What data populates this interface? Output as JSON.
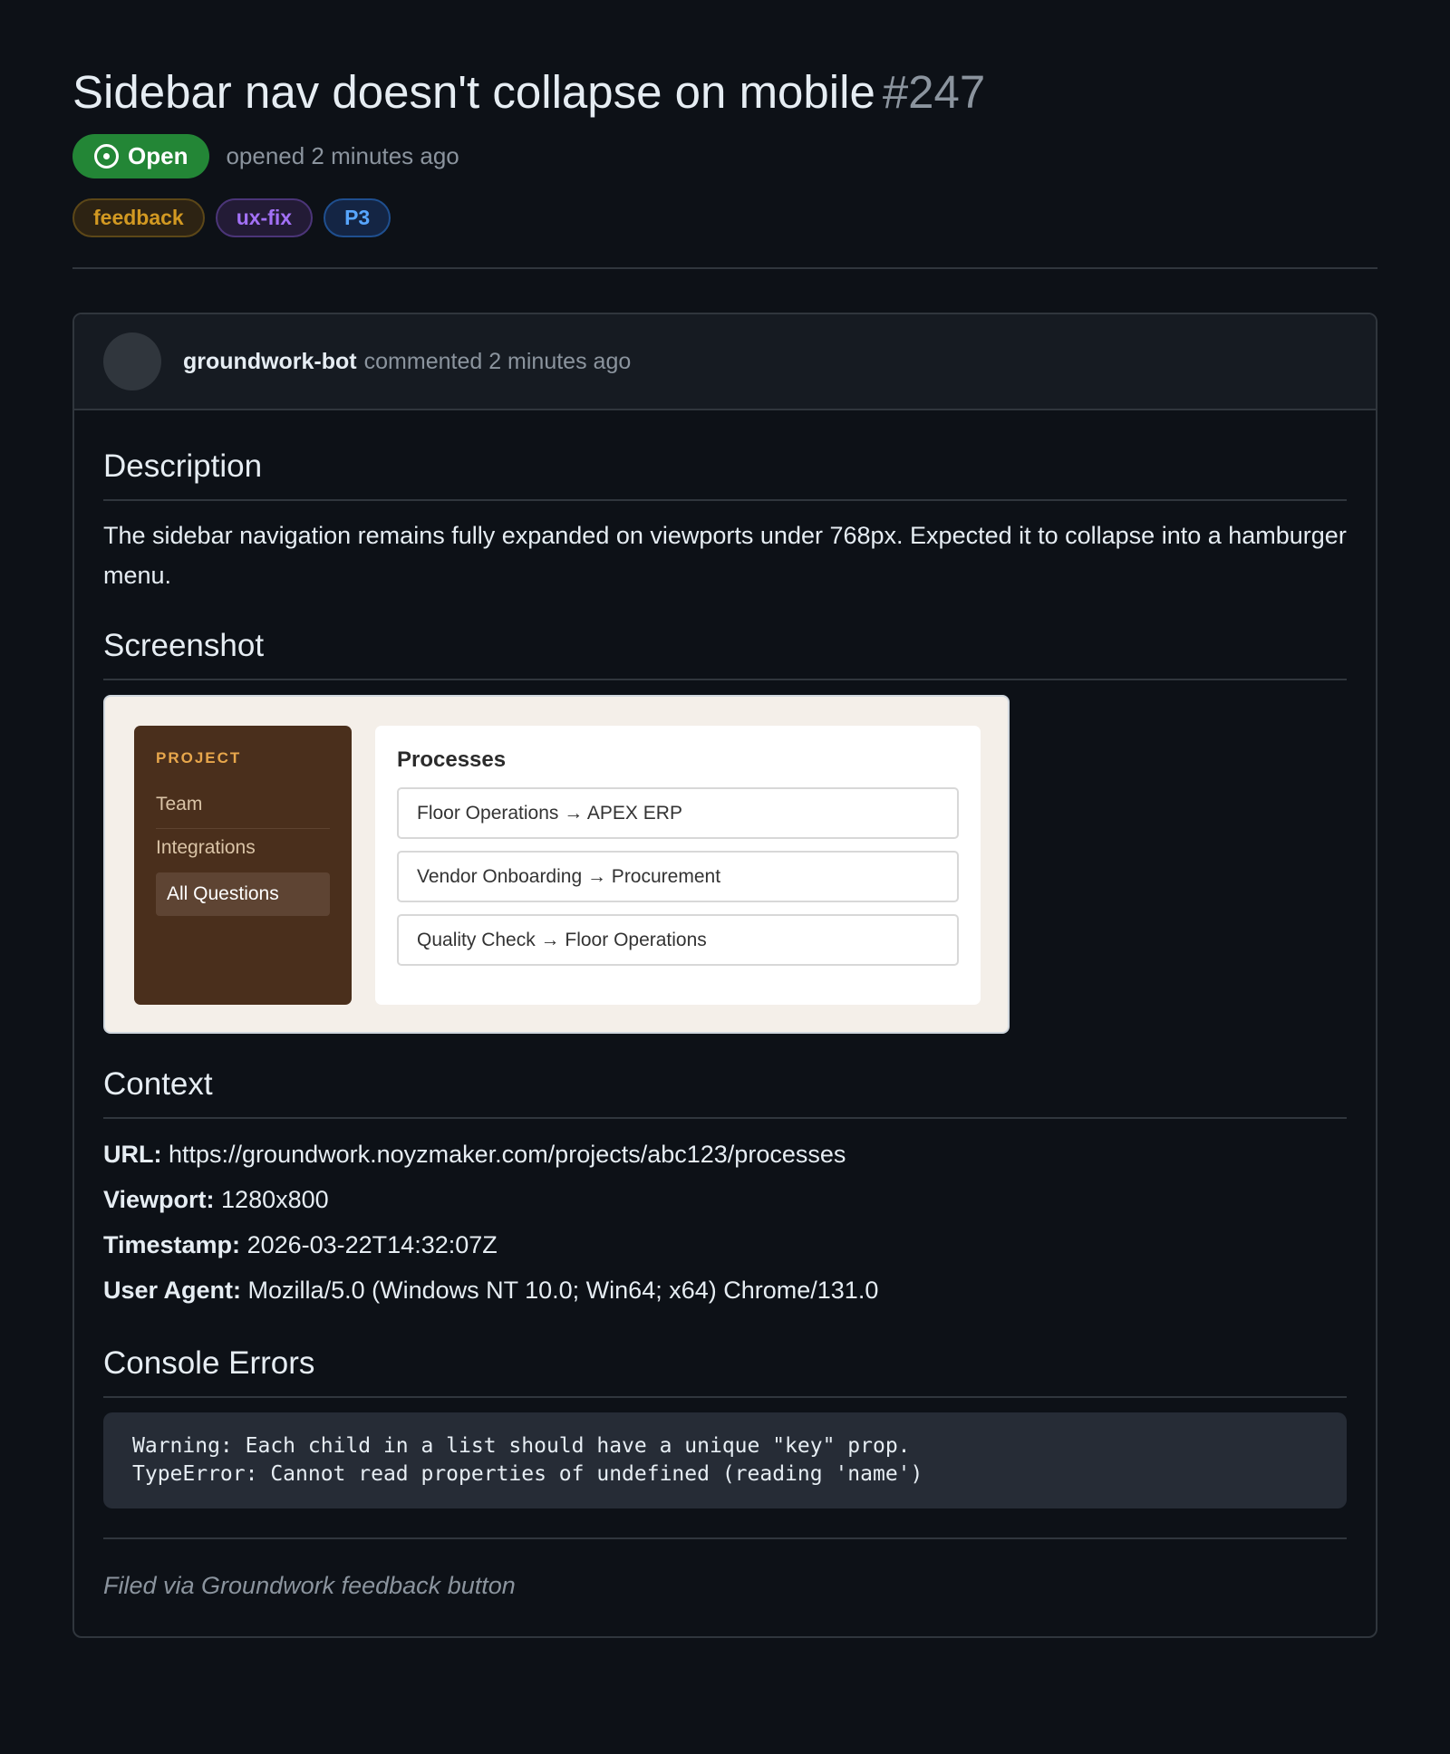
{
  "issue": {
    "title": "Sidebar nav doesn't collapse on mobile",
    "number": "#247",
    "state": "Open",
    "opened_text": "opened 2 minutes ago",
    "labels": [
      {
        "text": "feedback",
        "color": "#d29922",
        "bg": "#2d2313"
      },
      {
        "text": "ux-fix",
        "color": "#a371f7",
        "bg": "#231b36"
      },
      {
        "text": "P3",
        "color": "#58a6ff",
        "bg": "#142544"
      }
    ]
  },
  "comment": {
    "author": "groundwork-bot",
    "ago": "commented 2 minutes ago",
    "description_heading": "Description",
    "description_text": "The sidebar navigation remains fully expanded on viewports under 768px. Expected it to collapse into a hamburger menu.",
    "screenshot_heading": "Screenshot",
    "screenshot": {
      "section_label": "PROJECT",
      "nav_items": [
        "Team",
        "Integrations",
        "All Questions"
      ],
      "main_title": "Processes",
      "rows": [
        "Floor Operations → APEX ERP",
        "Vendor Onboarding → Procurement",
        "Quality Check → Floor Operations"
      ]
    },
    "context_heading": "Context",
    "context": [
      {
        "key": "URL:",
        "value": "https://groundwork.noyzmaker.com/projects/abc123/processes"
      },
      {
        "key": "Viewport:",
        "value": "1280x800"
      },
      {
        "key": "Timestamp:",
        "value": "2026-03-22T14:32:07Z"
      },
      {
        "key": "User Agent:",
        "value": "Mozilla/5.0 (Windows NT 10.0; Win64; x64) Chrome/131.0"
      }
    ],
    "console_heading": "Console Errors",
    "console_lines": [
      "Warning: Each child in a list should have a unique \"key\" prop.",
      "TypeError: Cannot read properties of undefined (reading 'name')"
    ],
    "footer_note": "Filed via Groundwork feedback button"
  },
  "colors": {
    "background": "#0d1117",
    "open_green": "#238636",
    "border": "#30363d",
    "muted": "#8b949e"
  }
}
